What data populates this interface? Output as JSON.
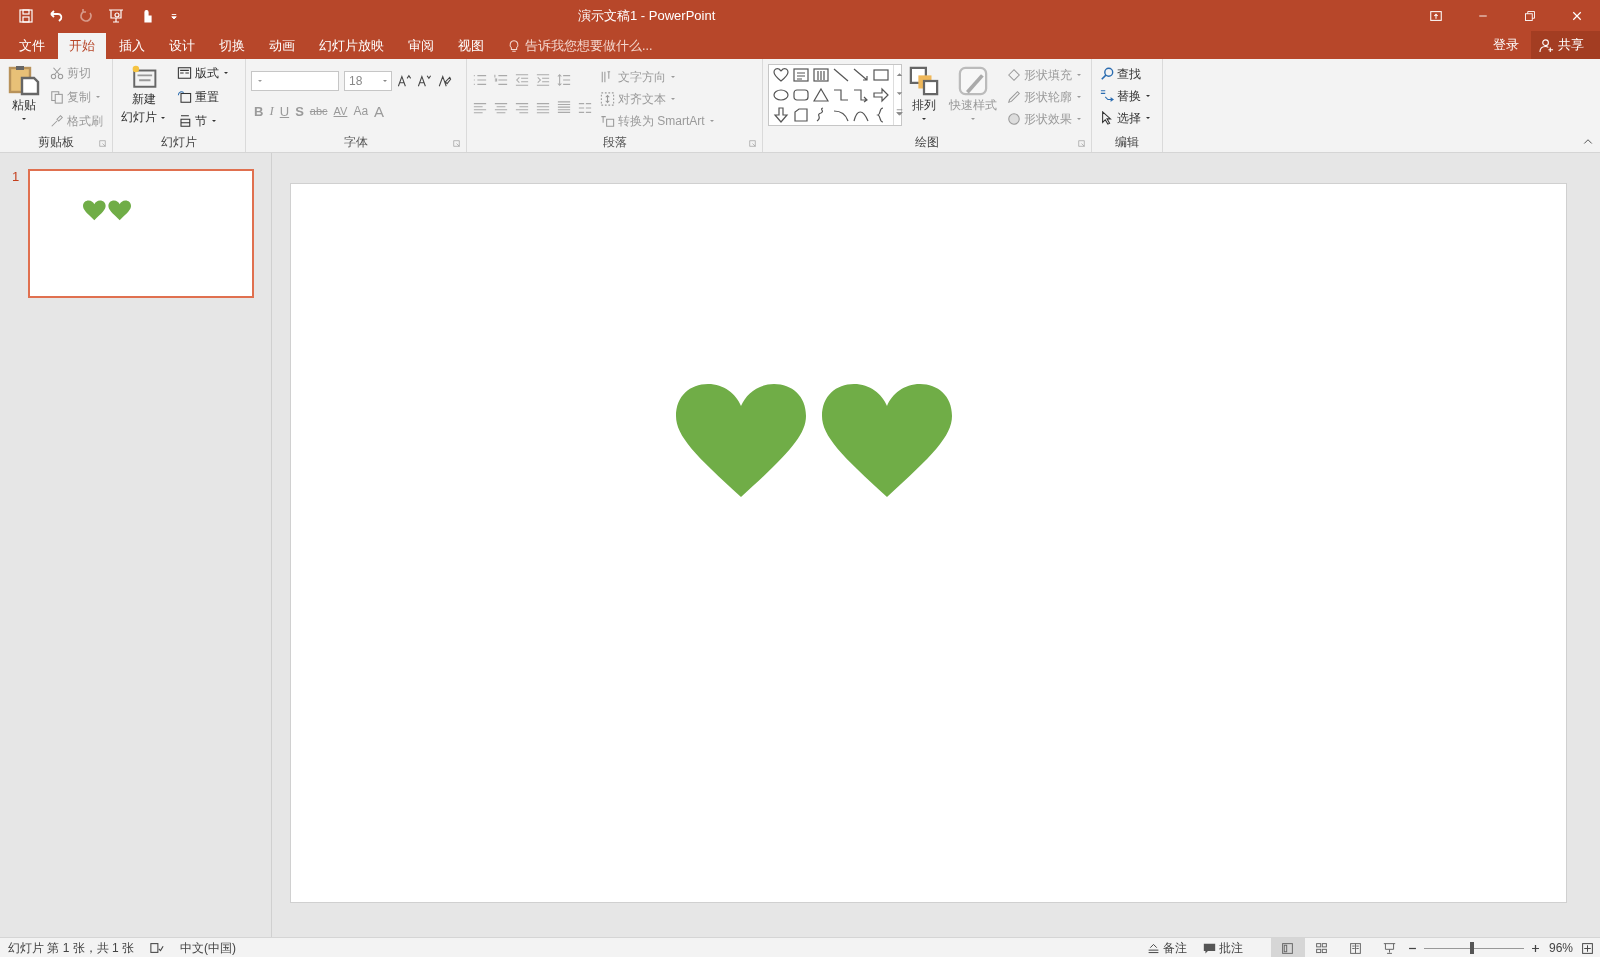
{
  "window": {
    "title": "演示文稿1 - PowerPoint"
  },
  "tabs": [
    {
      "label": "文件",
      "selected": false
    },
    {
      "label": "开始",
      "selected": true
    },
    {
      "label": "插入",
      "selected": false
    },
    {
      "label": "设计",
      "selected": false
    },
    {
      "label": "切换",
      "selected": false
    },
    {
      "label": "动画",
      "selected": false
    },
    {
      "label": "幻灯片放映",
      "selected": false
    },
    {
      "label": "审阅",
      "selected": false
    },
    {
      "label": "视图",
      "selected": false
    }
  ],
  "tell_me": {
    "placeholder": "告诉我您想要做什么..."
  },
  "account": {
    "sign_in": "登录",
    "share": "共享"
  },
  "ribbon": {
    "clipboard": {
      "label": "剪贴板",
      "paste": "粘贴",
      "small": [
        {
          "label": "剪切",
          "disabled": true
        },
        {
          "label": "复制",
          "disabled": true
        },
        {
          "label": "格式刷",
          "disabled": true
        }
      ]
    },
    "slides": {
      "label": "幻灯片",
      "new_slide": [
        "新建",
        "幻灯片"
      ],
      "small": [
        {
          "label": "版式",
          "disabled": false
        },
        {
          "label": "重置",
          "disabled": false
        },
        {
          "label": "节",
          "disabled": false
        }
      ]
    },
    "font": {
      "label": "字体",
      "disabled": true,
      "size": "18",
      "buttons": [
        "B",
        "I",
        "U",
        "S",
        "abc",
        "AV",
        "Aa",
        "A"
      ]
    },
    "paragraph": {
      "label": "段落",
      "disabled": true,
      "small": [
        {
          "label": "文字方向",
          "disabled": true
        },
        {
          "label": "对齐文本",
          "disabled": true
        },
        {
          "label": "转换为 SmartArt",
          "disabled": true
        }
      ]
    },
    "drawing": {
      "label": "绘图",
      "arrange": {
        "label": "排列",
        "disabled": false
      },
      "quick_styles": {
        "label": "快速样式",
        "disabled": true
      },
      "small": [
        {
          "label": "形状填充",
          "disabled": true
        },
        {
          "label": "形状轮廓",
          "disabled": true
        },
        {
          "label": "形状效果",
          "disabled": true
        }
      ]
    },
    "editing": {
      "label": "编辑",
      "small": [
        {
          "label": "查找",
          "disabled": false
        },
        {
          "label": "替换",
          "disabled": false
        },
        {
          "label": "选择",
          "disabled": false
        }
      ]
    }
  },
  "thumbnails": [
    {
      "number": "1",
      "selected": true
    }
  ],
  "slide": {
    "shapes": [
      {
        "kind": "heart",
        "color": "#70ad47"
      },
      {
        "kind": "heart",
        "color": "#70ad47"
      }
    ]
  },
  "status_bar": {
    "slide_info": "幻灯片 第 1 张，共 1 张",
    "language": "中文(中国)",
    "notes": "备注",
    "comments": "批注",
    "views": [
      {
        "selected": true
      },
      {
        "selected": false
      },
      {
        "selected": false
      },
      {
        "selected": false
      }
    ],
    "zoom": {
      "level": 0.48,
      "reading": "96%"
    }
  }
}
